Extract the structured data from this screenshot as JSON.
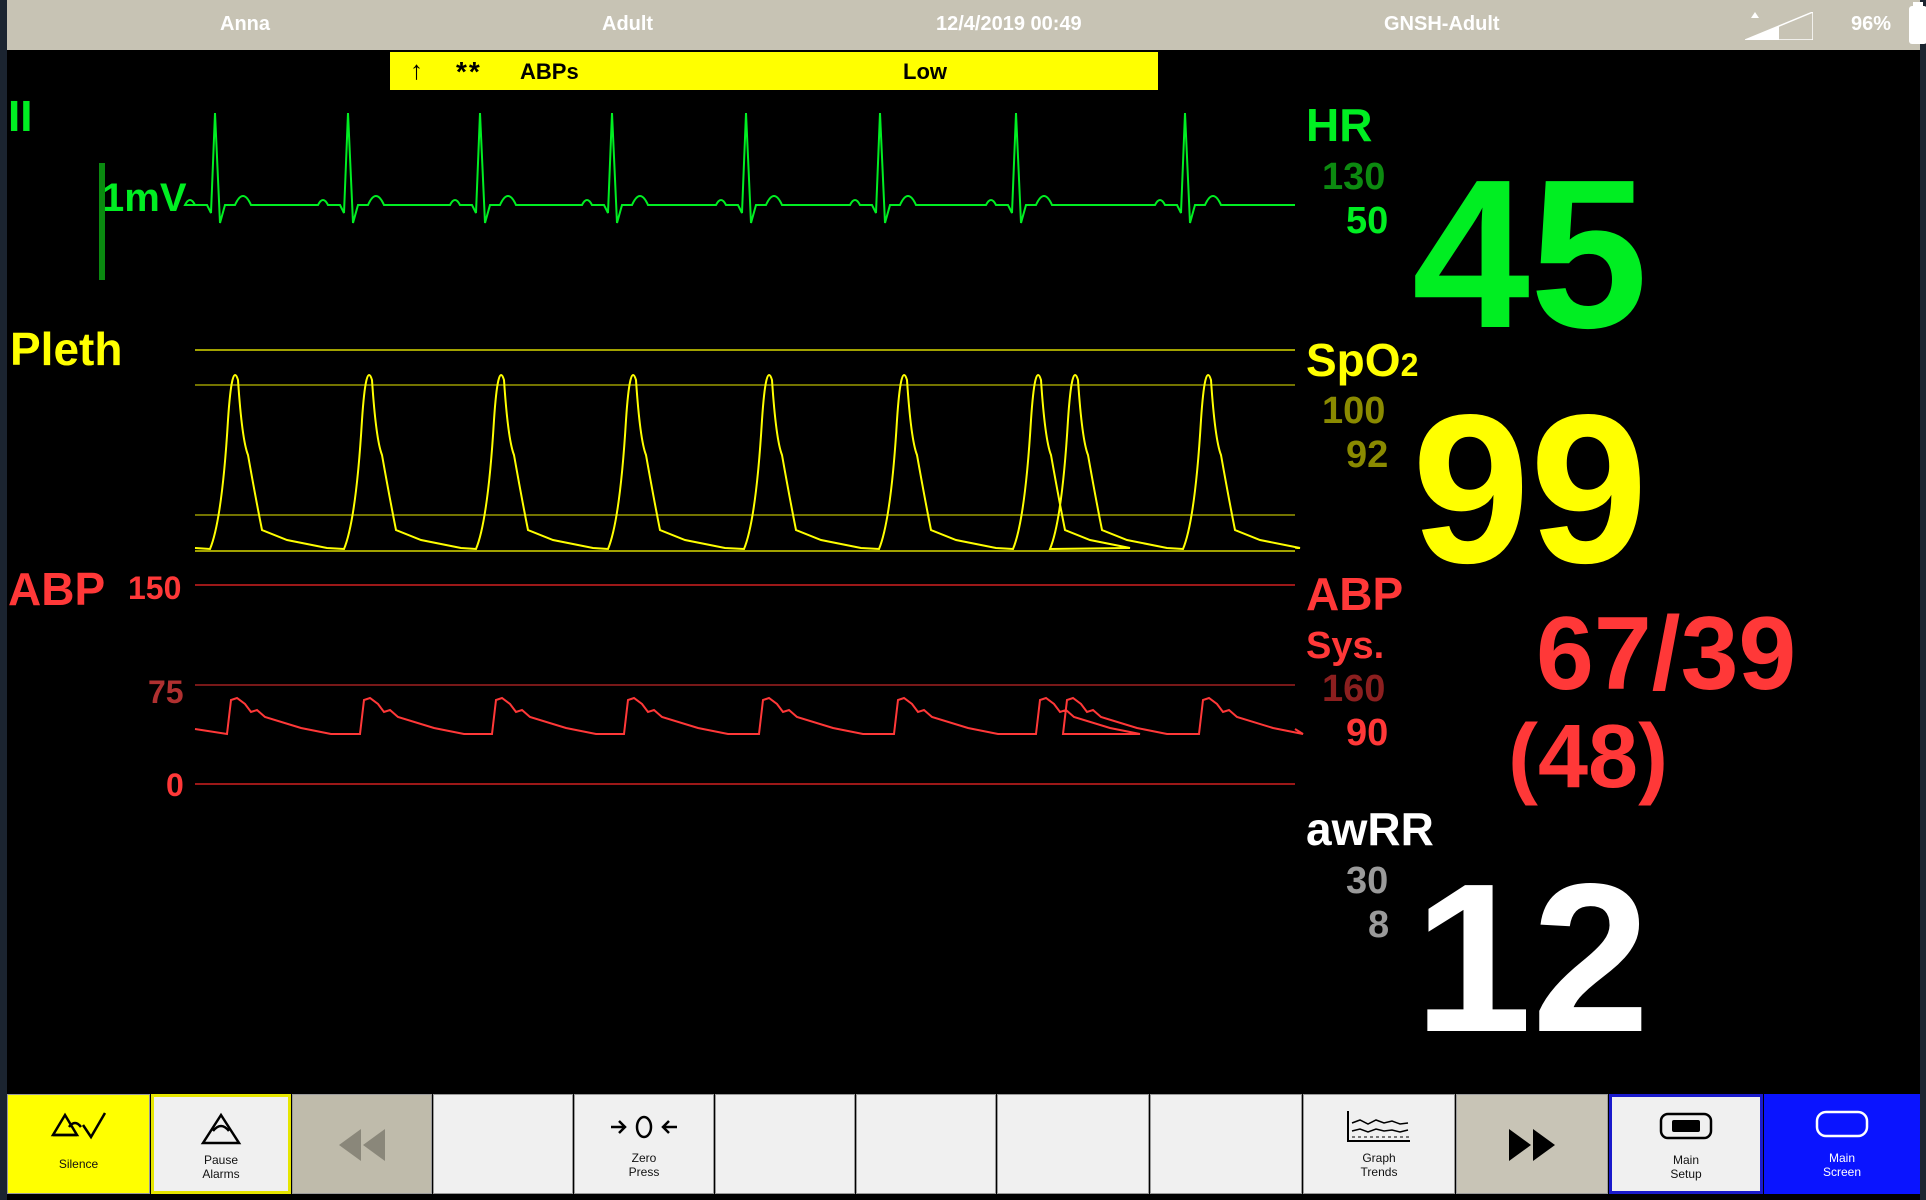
{
  "status_bar": {
    "patient_name": "Anna",
    "patient_type": "Adult",
    "datetime": "12/4/2019 00:49",
    "profile": "GNSH-Adult",
    "battery": "96%"
  },
  "alarm": {
    "arrow": "↑",
    "priority": "**",
    "source": "ABPs",
    "message": "Low"
  },
  "waves": {
    "ecg_lead": "II",
    "ecg_scale": "1mV",
    "pleth_label": "Pleth",
    "abp_label": "ABP",
    "abp_scale": [
      "150",
      "75",
      "0"
    ]
  },
  "params": {
    "hr": {
      "label": "HR",
      "high": "130",
      "low": "50",
      "value": "45"
    },
    "spo2": {
      "label": "SpO",
      "sub": "2",
      "high": "100",
      "low": "92",
      "value": "99"
    },
    "abp": {
      "label": "ABP",
      "sublabel": "Sys.",
      "high": "160",
      "low": "90",
      "value": "67/39",
      "mean": "(48)"
    },
    "awrr": {
      "label": "awRR",
      "high": "30",
      "low": "8",
      "value": "12"
    }
  },
  "softkeys": [
    {
      "label": "Silence",
      "icon": "silence-icon"
    },
    {
      "label": "Pause\nAlarms",
      "icon": "alarm-bell-icon"
    },
    {
      "label": "",
      "icon": "rewind-icon"
    },
    {
      "label": ""
    },
    {
      "label": "Zero\nPress",
      "icon": "zero-pressure-icon"
    },
    {
      "label": ""
    },
    {
      "label": ""
    },
    {
      "label": ""
    },
    {
      "label": ""
    },
    {
      "label": "Graph\nTrends",
      "icon": "graph-trends-icon"
    },
    {
      "label": "",
      "icon": "fast-forward-icon"
    },
    {
      "label": "Main\nSetup",
      "icon": "main-setup-icon"
    },
    {
      "label": "Main\nScreen",
      "icon": "main-screen-icon"
    }
  ],
  "colors": {
    "ecg": "#00ee22",
    "pleth": "#ffff00",
    "abp": "#ff3838",
    "awrr": "#ffffff",
    "alarm_banner": "#ffff00",
    "selected_key": "#0a14ff"
  }
}
